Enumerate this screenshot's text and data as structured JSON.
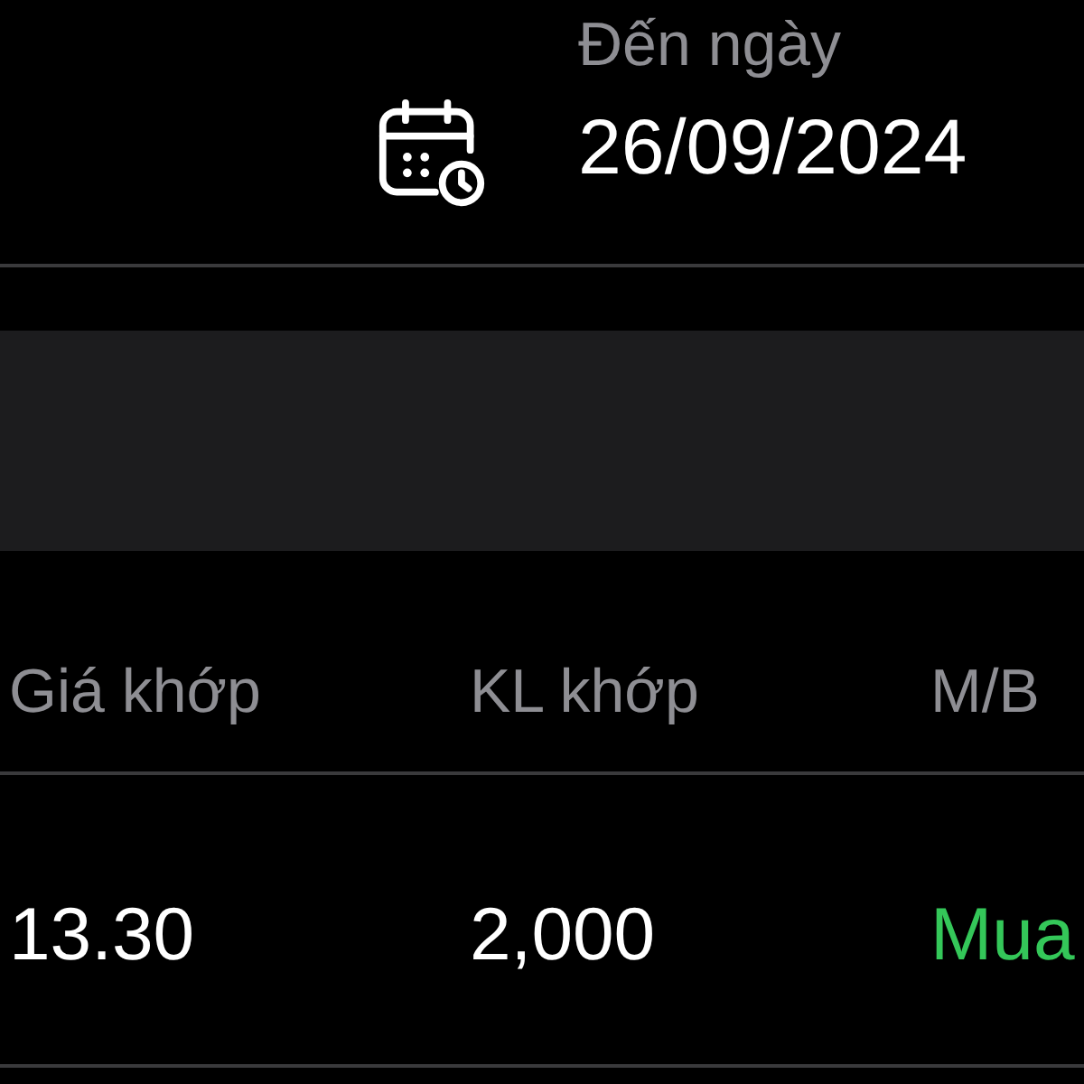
{
  "date_filter": {
    "label": "Đến ngày",
    "value": "26/09/2024"
  },
  "table": {
    "columns": [
      "Giá khớp",
      "KL khớp",
      "M/B"
    ],
    "rows": [
      {
        "price": "13.30",
        "volume": "2,000",
        "side": {
          "text": "Mua",
          "kind": "buy"
        }
      }
    ]
  }
}
